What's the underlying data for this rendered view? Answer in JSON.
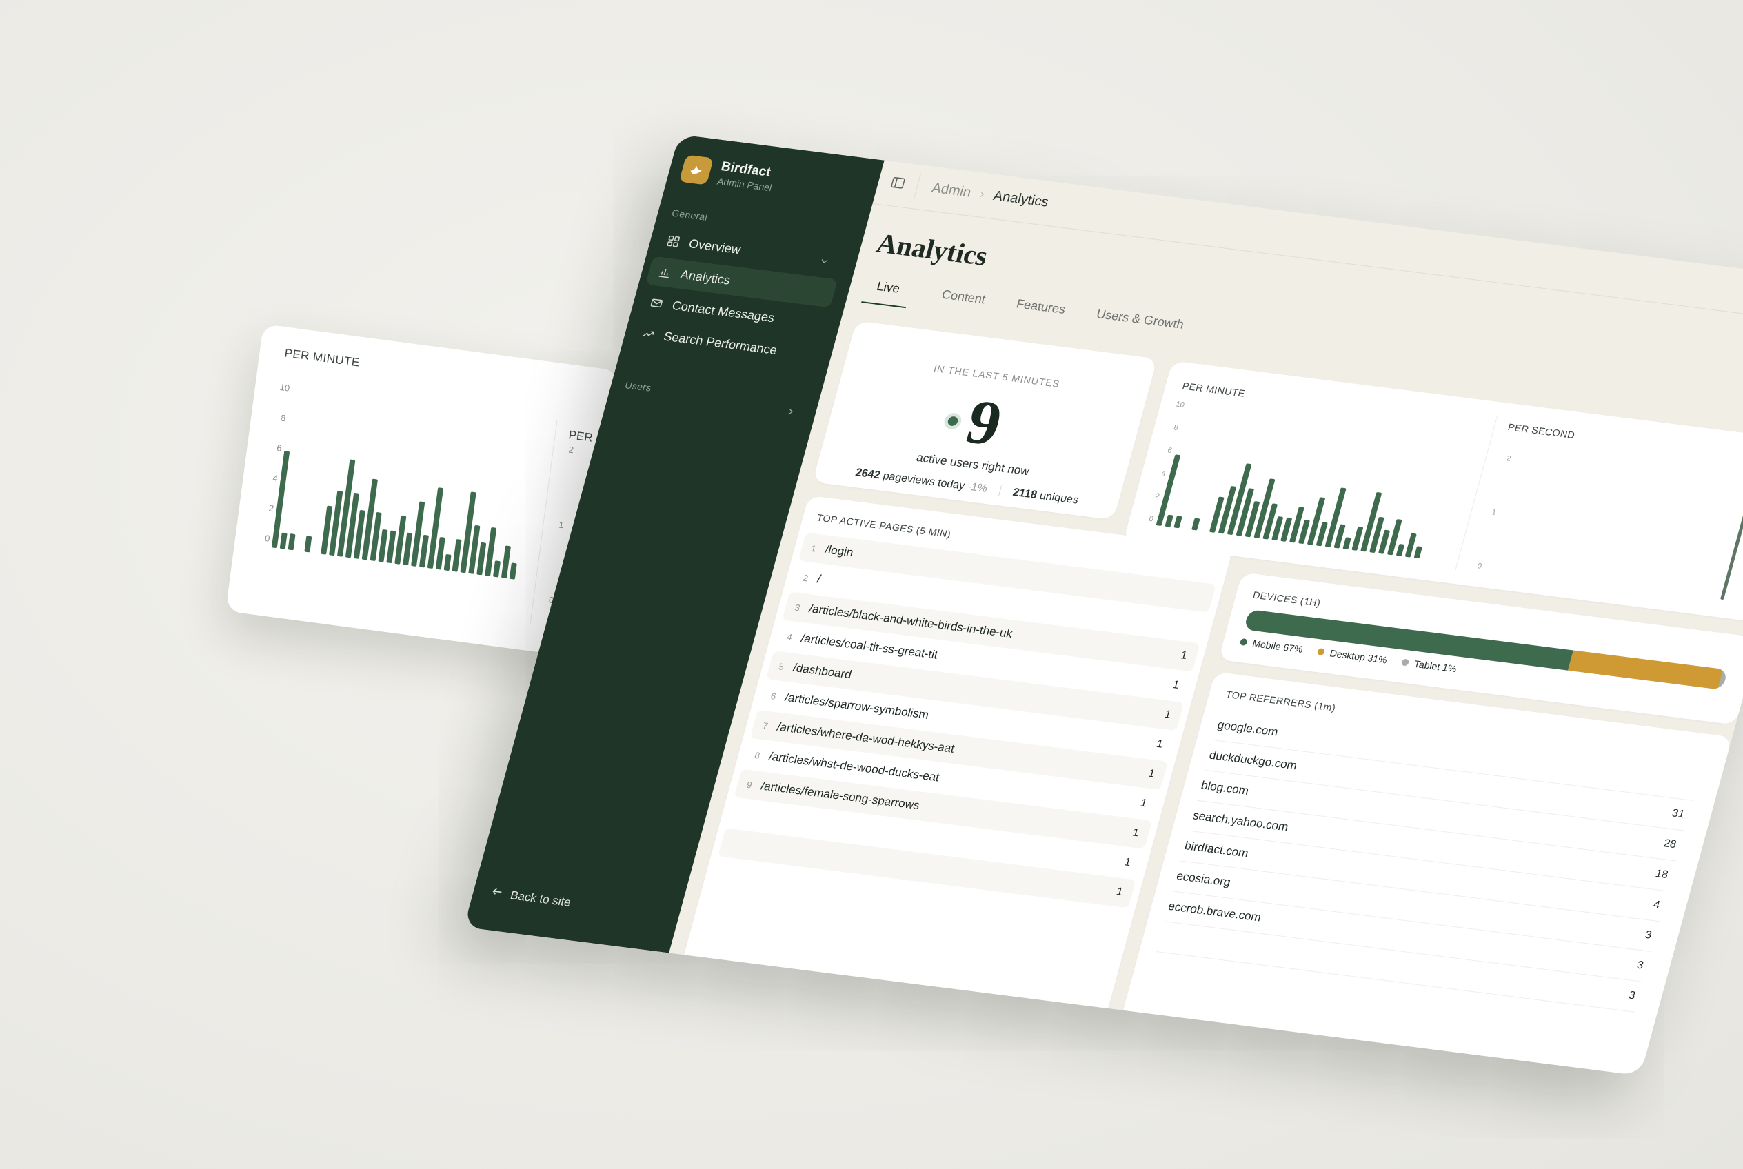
{
  "background_card": {
    "title": "PER MINUTE",
    "subtitle": "PER",
    "y_ticks": [
      "10",
      "8",
      "6",
      "4",
      "2",
      "0"
    ],
    "y2_ticks": [
      "2",
      "1",
      "0"
    ]
  },
  "sidebar": {
    "brand_name": "Birdfact",
    "brand_sub": "Admin Panel",
    "groups": [
      {
        "label": "General"
      },
      {
        "label": "Users"
      }
    ],
    "items": [
      {
        "label": "Overview",
        "icon": "grid-icon"
      },
      {
        "label": "Analytics",
        "icon": "bar-chart-icon",
        "active": true
      },
      {
        "label": "Contact Messages",
        "icon": "mail-icon"
      },
      {
        "label": "Search Performance",
        "icon": "trend-icon"
      }
    ],
    "back_label": "Back to site"
  },
  "topbar": {
    "breadcrumb": [
      "Admin",
      "Analytics"
    ]
  },
  "page": {
    "title": "Analytics",
    "tabs": [
      {
        "label": "Live",
        "active": true
      },
      {
        "label": "Content"
      },
      {
        "label": "Features"
      },
      {
        "label": "Users & Growth"
      }
    ]
  },
  "live": {
    "caption": "IN THE LAST 5 MINUTES",
    "active_users": "9",
    "active_label": "active users right now",
    "pageviews": "2642",
    "pageviews_label": "pageviews today",
    "pageviews_change": "-1%",
    "uniques": "2118",
    "uniques_label": "uniques"
  },
  "charts": {
    "per_minute_title": "PER MINUTE",
    "per_second_title": "PER SECOND"
  },
  "chart_data": [
    {
      "type": "bar",
      "title": "PER MINUTE",
      "ylim": [
        0,
        10
      ],
      "y_ticks": [
        "10",
        "8",
        "6",
        "4",
        "2",
        "0"
      ],
      "values": [
        6,
        1,
        1,
        0,
        1,
        0,
        3,
        4,
        6,
        4,
        3,
        5,
        3,
        2,
        2,
        3,
        2,
        4,
        2,
        5,
        2,
        1,
        2,
        5,
        3,
        2,
        3,
        1,
        2,
        1
      ]
    },
    {
      "type": "bar",
      "title": "PER SECOND",
      "ylim": [
        0,
        2
      ],
      "y_ticks": [
        "2",
        "1",
        "0"
      ],
      "values": [
        0,
        0,
        0,
        0,
        0,
        0,
        0,
        0,
        0,
        0,
        0,
        0,
        0,
        0,
        0,
        0,
        0,
        0,
        0,
        2
      ]
    }
  ],
  "top_pages": {
    "title": "TOP ACTIVE PAGES (5 MIN)",
    "rows": [
      {
        "rank": "1",
        "path": "/login",
        "count": ""
      },
      {
        "rank": "2",
        "path": "/",
        "count": ""
      },
      {
        "rank": "3",
        "path": "/articles/black-and-white-birds-in-the-uk",
        "count": "1"
      },
      {
        "rank": "4",
        "path": "/articles/coal-tit-ss-great-tit",
        "count": "1"
      },
      {
        "rank": "5",
        "path": "/dashboard",
        "count": "1"
      },
      {
        "rank": "6",
        "path": "/articles/sparrow-symbolism",
        "count": "1"
      },
      {
        "rank": "7",
        "path": "/articles/where-da-wod-hekkys-aat",
        "count": "1"
      },
      {
        "rank": "8",
        "path": "/articles/whst-de-wood-ducks-eat",
        "count": "1"
      },
      {
        "rank": "9",
        "path": "/articles/female-song-sparrows",
        "count": "1"
      },
      {
        "rank": "",
        "path": "",
        "count": "1"
      },
      {
        "rank": "",
        "path": "",
        "count": "1"
      }
    ]
  },
  "devices": {
    "title": "DEVICES (1H)",
    "segments": [
      {
        "label": "Mobile 67%",
        "value": 67,
        "color": "#3e6b4d"
      },
      {
        "label": "Desktop 31%",
        "value": 31,
        "color": "#cf9a34"
      },
      {
        "label": "Tablet 1%",
        "value": 1,
        "color": "#a9ada8"
      }
    ]
  },
  "referrers": {
    "title": "TOP REFERRERS (1m)",
    "rows": [
      {
        "name": "google.com",
        "count": ""
      },
      {
        "name": "duckduckgo.com",
        "count": "31"
      },
      {
        "name": "blog.com",
        "count": "28"
      },
      {
        "name": "search.yahoo.com",
        "count": "18"
      },
      {
        "name": "birdfact.com",
        "count": "4"
      },
      {
        "name": "ecosia.org",
        "count": "3"
      },
      {
        "name": "eccrob.brave.com",
        "count": "3"
      },
      {
        "name": "",
        "count": "3"
      }
    ]
  },
  "colors": {
    "sidebar": "#1f3527",
    "accent": "#3e6b4d",
    "brand": "#c89a3a",
    "bar": "#3e6b4d"
  }
}
